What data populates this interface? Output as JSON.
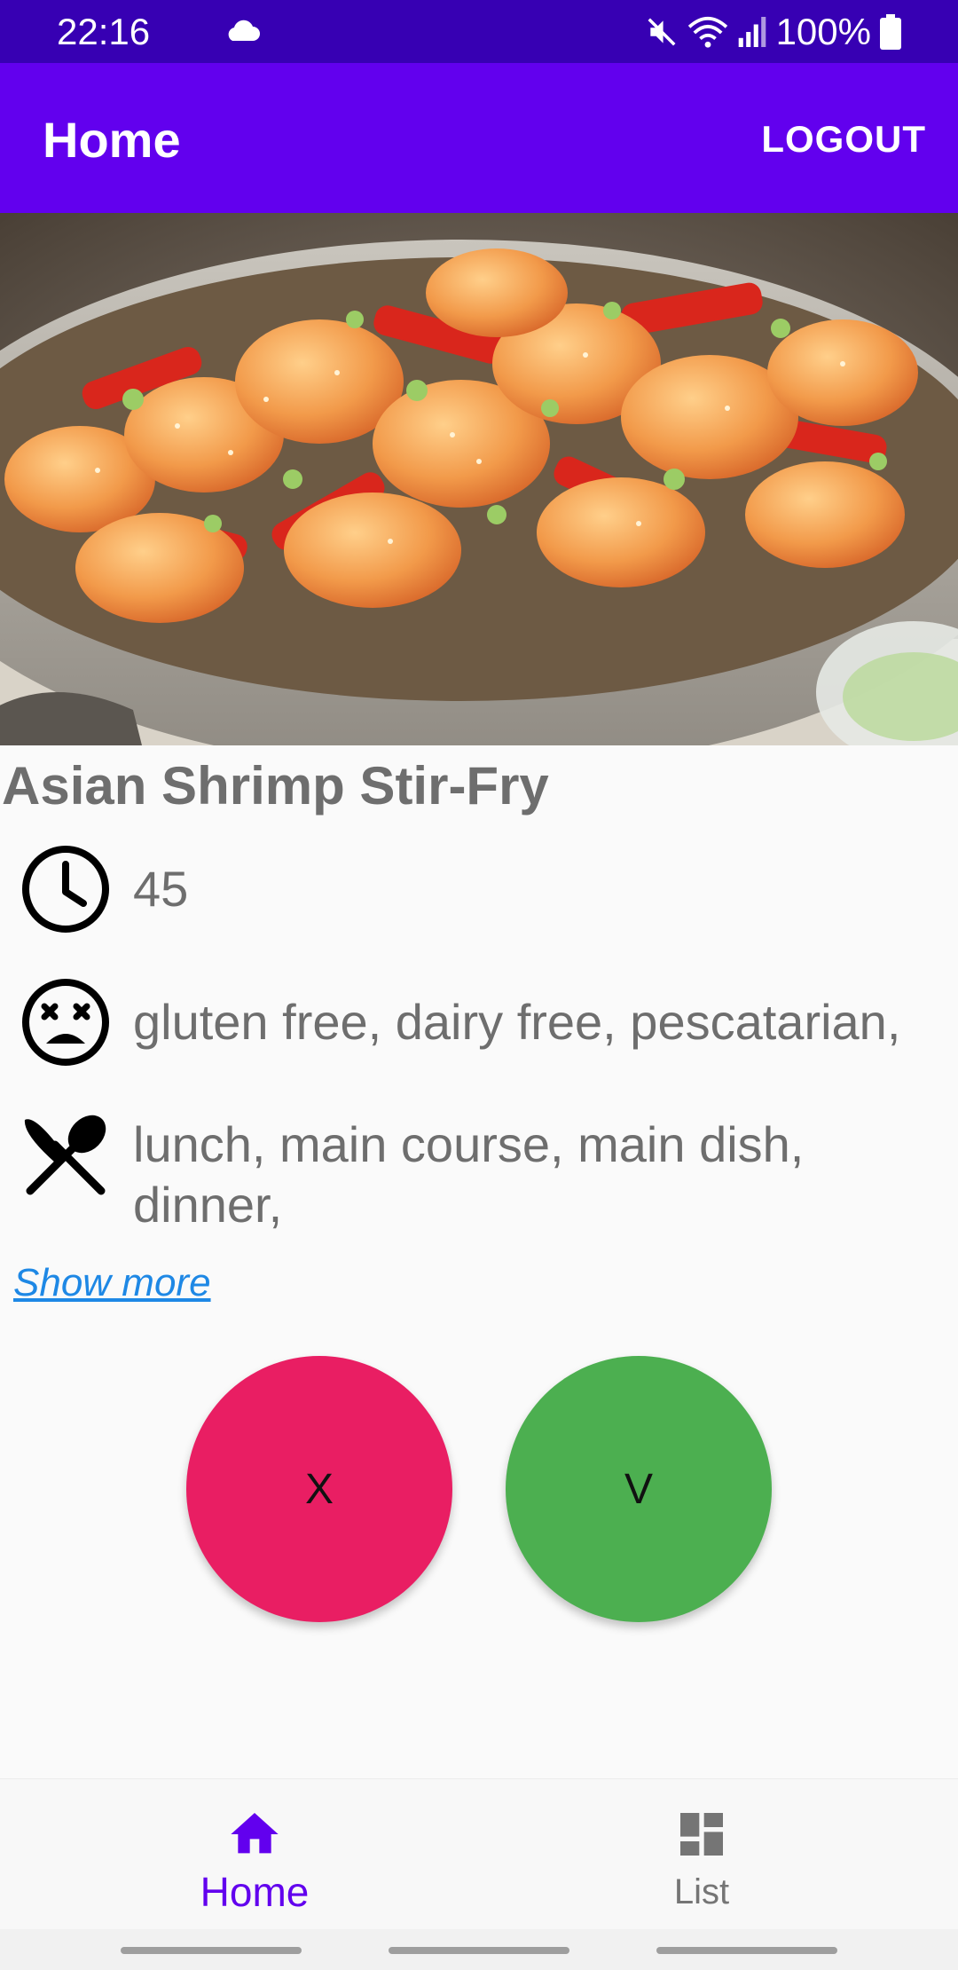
{
  "status_bar": {
    "time": "22:16",
    "battery": "100%",
    "icons": [
      "cloud-icon",
      "mute-icon",
      "wifi-icon",
      "signal-icon",
      "battery-icon"
    ]
  },
  "app_bar": {
    "title": "Home",
    "logout_label": "LOGOUT"
  },
  "recipe": {
    "title": "Asian Shrimp Stir-Fry",
    "time": "45",
    "diets": "gluten free, dairy free, pescatarian,",
    "dish_types": "lunch, main course, main dish, dinner,",
    "show_more_label": "Show more"
  },
  "actions": {
    "reject_label": "X",
    "accept_label": "V"
  },
  "bottom_nav": {
    "items": [
      {
        "label": "Home",
        "icon": "home-icon",
        "active": true
      },
      {
        "label": "List",
        "icon": "dashboard-icon",
        "active": false
      }
    ]
  },
  "colors": {
    "status_bar": "#3700b3",
    "app_bar": "#6200ee",
    "reject": "#e91e63",
    "accept": "#4caf50",
    "link": "#1e88e5",
    "text_gray": "#6e6e6e"
  }
}
